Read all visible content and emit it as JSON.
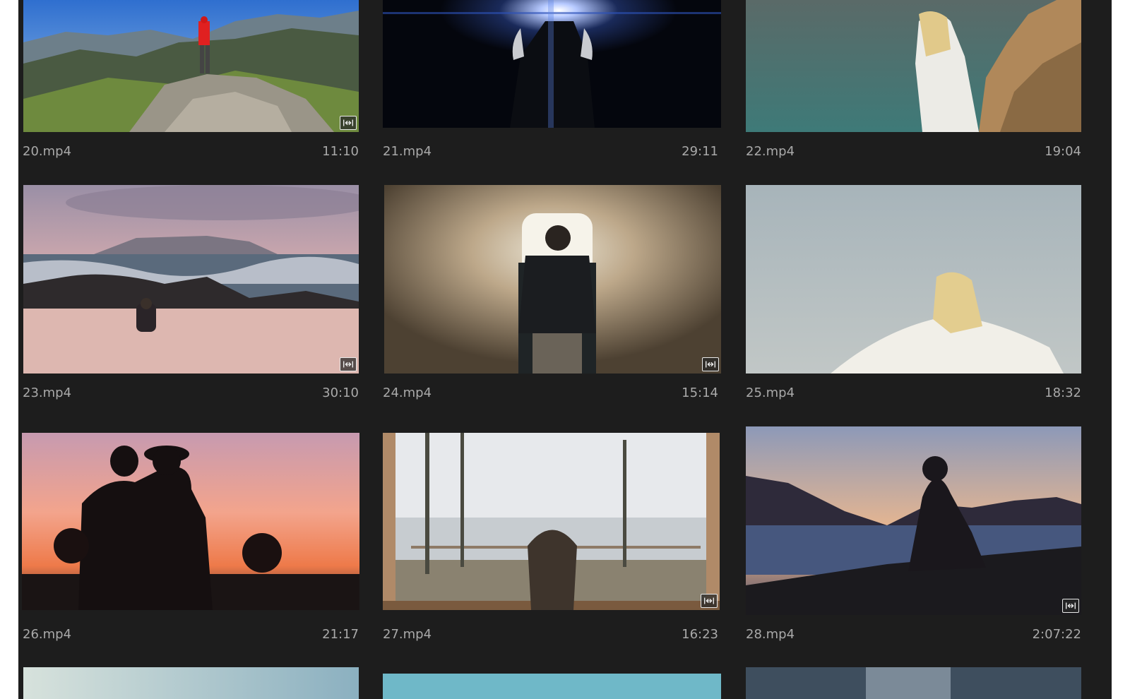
{
  "clips": [
    {
      "name": "20.mp4",
      "duration": "11:10"
    },
    {
      "name": "21.mp4",
      "duration": "29:11"
    },
    {
      "name": "22.mp4",
      "duration": "19:04"
    },
    {
      "name": "23.mp4",
      "duration": "30:10"
    },
    {
      "name": "24.mp4",
      "duration": "15:14"
    },
    {
      "name": "25.mp4",
      "duration": "18:32"
    },
    {
      "name": "26.mp4",
      "duration": "21:17"
    },
    {
      "name": "27.mp4",
      "duration": "16:23"
    },
    {
      "name": "28.mp4",
      "duration": "2:07:22"
    }
  ],
  "icons": {
    "clip_badge": "audio-video-clip-icon"
  }
}
